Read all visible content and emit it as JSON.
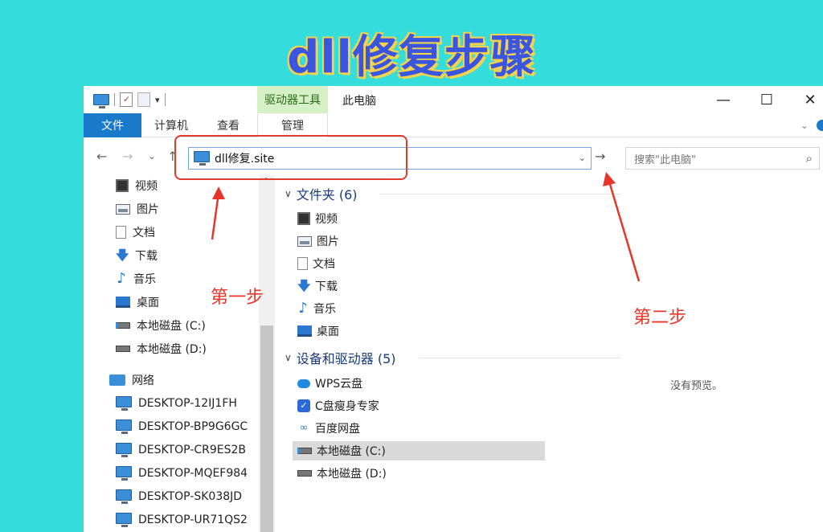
{
  "banner": {
    "title": "dll修复步骤"
  },
  "window": {
    "context_tab": "驱动器工具",
    "title": "此电脑",
    "controls": {
      "minimize": "—",
      "maximize": "☐",
      "close": "✕"
    }
  },
  "ribbon": {
    "tabs": [
      {
        "label": "文件"
      },
      {
        "label": "计算机"
      },
      {
        "label": "查看"
      },
      {
        "label": "管理"
      }
    ]
  },
  "nav": {
    "back": "←",
    "forward": "→",
    "recent": "⌄",
    "up": "↑",
    "address": "dll修复.site",
    "go": "→",
    "search_placeholder": "搜索\"此电脑\""
  },
  "sidebar": {
    "items": [
      {
        "label": "视频",
        "icon": "video-icon"
      },
      {
        "label": "图片",
        "icon": "pictures-icon"
      },
      {
        "label": "文档",
        "icon": "documents-icon"
      },
      {
        "label": "下载",
        "icon": "download-icon"
      },
      {
        "label": "音乐",
        "icon": "music-icon"
      },
      {
        "label": "桌面",
        "icon": "desktop-icon"
      },
      {
        "label": "本地磁盘 (C:)",
        "icon": "drive-icon"
      },
      {
        "label": "本地磁盘 (D:)",
        "icon": "drive-icon"
      },
      {
        "label": "网络",
        "icon": "network-icon"
      },
      {
        "label": "DESKTOP-12IJ1FH",
        "icon": "computer-icon"
      },
      {
        "label": "DESKTOP-BP9G6GC",
        "icon": "computer-icon"
      },
      {
        "label": "DESKTOP-CR9ES2B",
        "icon": "computer-icon"
      },
      {
        "label": "DESKTOP-MQEF984",
        "icon": "computer-icon"
      },
      {
        "label": "DESKTOP-SK038JD",
        "icon": "computer-icon"
      },
      {
        "label": "DESKTOP-UR71QS2",
        "icon": "computer-icon"
      }
    ]
  },
  "content": {
    "folders_header": "文件夹 (6)",
    "folders": [
      {
        "label": "视频"
      },
      {
        "label": "图片"
      },
      {
        "label": "文档"
      },
      {
        "label": "下载"
      },
      {
        "label": "音乐"
      },
      {
        "label": "桌面"
      }
    ],
    "devices_header": "设备和驱动器 (5)",
    "devices": [
      {
        "label": "WPS云盘"
      },
      {
        "label": "C盘瘦身专家"
      },
      {
        "label": "百度网盘"
      },
      {
        "label": "本地磁盘 (C:)"
      },
      {
        "label": "本地磁盘 (D:)"
      }
    ],
    "preview_text": "没有预览。"
  },
  "annotations": {
    "step1": "第一步",
    "step2": "第二步",
    "color": "#e8352a"
  }
}
